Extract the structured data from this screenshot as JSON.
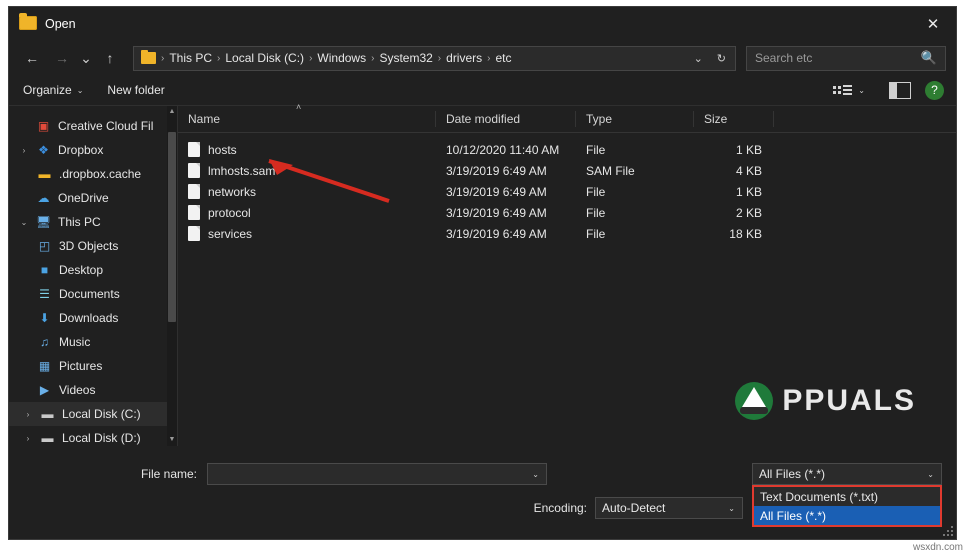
{
  "window": {
    "title": "Open",
    "close_label": "✕",
    "title_icon": "folder-icon"
  },
  "nav": {
    "back": "←",
    "forward": "→",
    "recent": "⌄",
    "up": "↑",
    "breadcrumb": [
      "This PC",
      "Local Disk (C:)",
      "Windows",
      "System32",
      "drivers",
      "etc"
    ],
    "breadcrumb_sep": "›",
    "history_caret": "⌄",
    "refresh": "↻",
    "search_placeholder": "Search etc",
    "search_icon": "🔍"
  },
  "commandbar": {
    "organize": "Organize",
    "organize_caret": "⌄",
    "new_folder": "New folder",
    "view_caret": "⌄",
    "help": "?"
  },
  "sidebar": {
    "scroll_up": "▲",
    "scroll_down": "▼",
    "items": [
      {
        "label": "Creative Cloud Fil",
        "icon": "creative-cloud-icon",
        "glyph": "▣",
        "color": "#e24b3b",
        "chevron": "",
        "indent": 0,
        "selected": false
      },
      {
        "label": "Dropbox",
        "icon": "dropbox-icon",
        "glyph": "❖",
        "color": "#3b8fe0",
        "chevron": "›",
        "indent": 0,
        "selected": false
      },
      {
        "label": ".dropbox.cache",
        "icon": "folder-icon",
        "glyph": "▬",
        "color": "#f0b429",
        "chevron": "",
        "indent": 1,
        "selected": false
      },
      {
        "label": "OneDrive",
        "icon": "onedrive-icon",
        "glyph": "☁",
        "color": "#4ba3e3",
        "chevron": "",
        "indent": 0,
        "selected": false
      },
      {
        "label": "This PC",
        "icon": "computer-icon",
        "glyph": "🖥",
        "color": "#6ab0e8",
        "chevron": "⌄",
        "indent": 0,
        "selected": false
      },
      {
        "label": "3D Objects",
        "icon": "3d-objects-icon",
        "glyph": "◰",
        "color": "#6ab0e8",
        "chevron": "",
        "indent": 1,
        "selected": false
      },
      {
        "label": "Desktop",
        "icon": "desktop-icon",
        "glyph": "■",
        "color": "#4ba3e3",
        "chevron": "",
        "indent": 1,
        "selected": false
      },
      {
        "label": "Documents",
        "icon": "documents-icon",
        "glyph": "☰",
        "color": "#7fd0e8",
        "chevron": "",
        "indent": 1,
        "selected": false
      },
      {
        "label": "Downloads",
        "icon": "downloads-icon",
        "glyph": "⬇",
        "color": "#4ba3e3",
        "chevron": "",
        "indent": 1,
        "selected": false
      },
      {
        "label": "Music",
        "icon": "music-icon",
        "glyph": "♫",
        "color": "#6ab0e8",
        "chevron": "",
        "indent": 1,
        "selected": false
      },
      {
        "label": "Pictures",
        "icon": "pictures-icon",
        "glyph": "▦",
        "color": "#6ab0e8",
        "chevron": "",
        "indent": 1,
        "selected": false
      },
      {
        "label": "Videos",
        "icon": "videos-icon",
        "glyph": "▶",
        "color": "#6ab0e8",
        "chevron": "",
        "indent": 1,
        "selected": false
      },
      {
        "label": "Local Disk (C:)",
        "icon": "drive-icon",
        "glyph": "▬",
        "color": "#c9c9c9",
        "chevron": "›",
        "indent": 1,
        "selected": true
      },
      {
        "label": "Local Disk (D:)",
        "icon": "drive-icon",
        "glyph": "▬",
        "color": "#c9c9c9",
        "chevron": "›",
        "indent": 1,
        "selected": false
      }
    ]
  },
  "filelist": {
    "columns": [
      "Name",
      "Date modified",
      "Type",
      "Size"
    ],
    "sort_indicator": "˄",
    "rows": [
      {
        "name": "hosts",
        "date": "10/12/2020 11:40 AM",
        "type": "File",
        "size": "1 KB"
      },
      {
        "name": "lmhosts.sam",
        "date": "3/19/2019 6:49 AM",
        "type": "SAM File",
        "size": "4 KB"
      },
      {
        "name": "networks",
        "date": "3/19/2019 6:49 AM",
        "type": "File",
        "size": "1 KB"
      },
      {
        "name": "protocol",
        "date": "3/19/2019 6:49 AM",
        "type": "File",
        "size": "2 KB"
      },
      {
        "name": "services",
        "date": "3/19/2019 6:49 AM",
        "type": "File",
        "size": "18 KB"
      }
    ]
  },
  "footer": {
    "filename_label": "File name:",
    "filename_value": "",
    "filename_caret": "⌄",
    "encoding_label": "Encoding:",
    "encoding_value": "Auto-Detect",
    "encoding_caret": "⌄",
    "filetype_value": "All Files  (*.*)",
    "filetype_caret": "⌄",
    "filetype_options": [
      {
        "label": "Text Documents (*.txt)",
        "selected": false
      },
      {
        "label": "All Files  (*.*)",
        "selected": true
      }
    ]
  },
  "watermark": {
    "text": "PPUALS",
    "wsx": "wsxdn.com"
  },
  "colors": {
    "accent_red": "#e03a2f",
    "select_blue": "#1a5fb4",
    "folder_yellow": "#f0b429"
  }
}
